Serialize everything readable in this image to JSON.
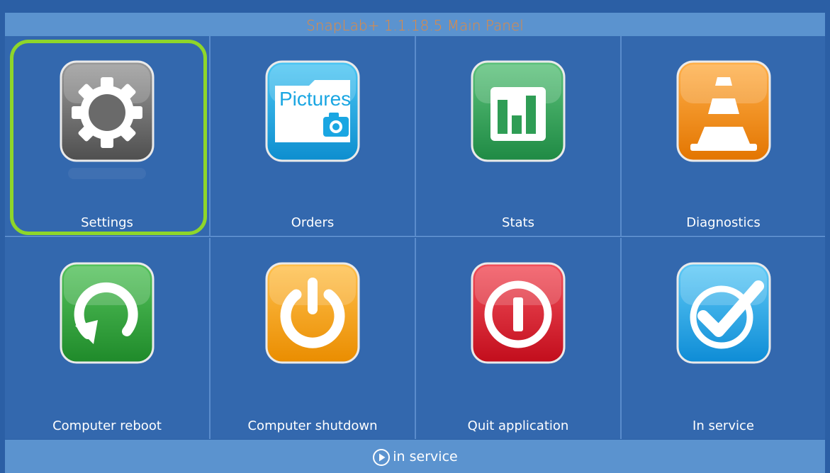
{
  "window": {
    "title": "SnapLab+ 1.1.18.5 Main Panel"
  },
  "tiles": [
    {
      "label": "Settings",
      "icon": "gear-icon",
      "color": "#6d6d6d",
      "selected": true
    },
    {
      "label": "Orders",
      "icon": "pictures-folder-icon",
      "color": "#1aa6e2",
      "folder_text": "Pictures"
    },
    {
      "label": "Stats",
      "icon": "bar-chart-icon",
      "color": "#2f9d55"
    },
    {
      "label": "Diagnostics",
      "icon": "traffic-cone-icon",
      "color": "#f08a1c"
    },
    {
      "label": "Computer reboot",
      "icon": "refresh-icon",
      "color": "#2f9d39"
    },
    {
      "label": "Computer shutdown",
      "icon": "power-icon",
      "color": "#f3a21b"
    },
    {
      "label": "Quit application",
      "icon": "stop-icon",
      "color": "#dd1c2a"
    },
    {
      "label": "In service",
      "icon": "checkmark-icon",
      "color": "#24a3e6"
    }
  ],
  "colors": {
    "selection_outline": "#8ed62a",
    "title_text": "#e8893a",
    "bar": "#5b93cf",
    "panel": "#3368ae"
  },
  "footer": {
    "status_icon": "play-circle-icon",
    "status_text": "in service"
  }
}
